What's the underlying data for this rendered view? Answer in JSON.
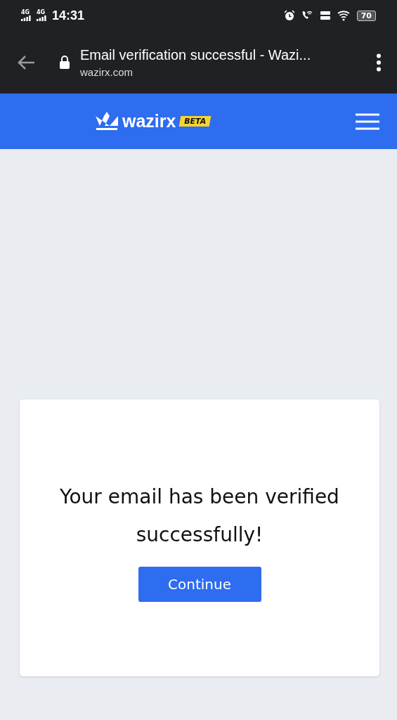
{
  "status_bar": {
    "network_labels": [
      "4G",
      "4G"
    ],
    "time": "14:31",
    "battery": "70"
  },
  "browser": {
    "page_title": "Email verification successful - Wazi...",
    "url": "wazirx.com"
  },
  "header": {
    "brand": "wazirx",
    "badge": "BETA"
  },
  "card": {
    "message": "Your email has been verified successfully!",
    "button": "Continue"
  }
}
